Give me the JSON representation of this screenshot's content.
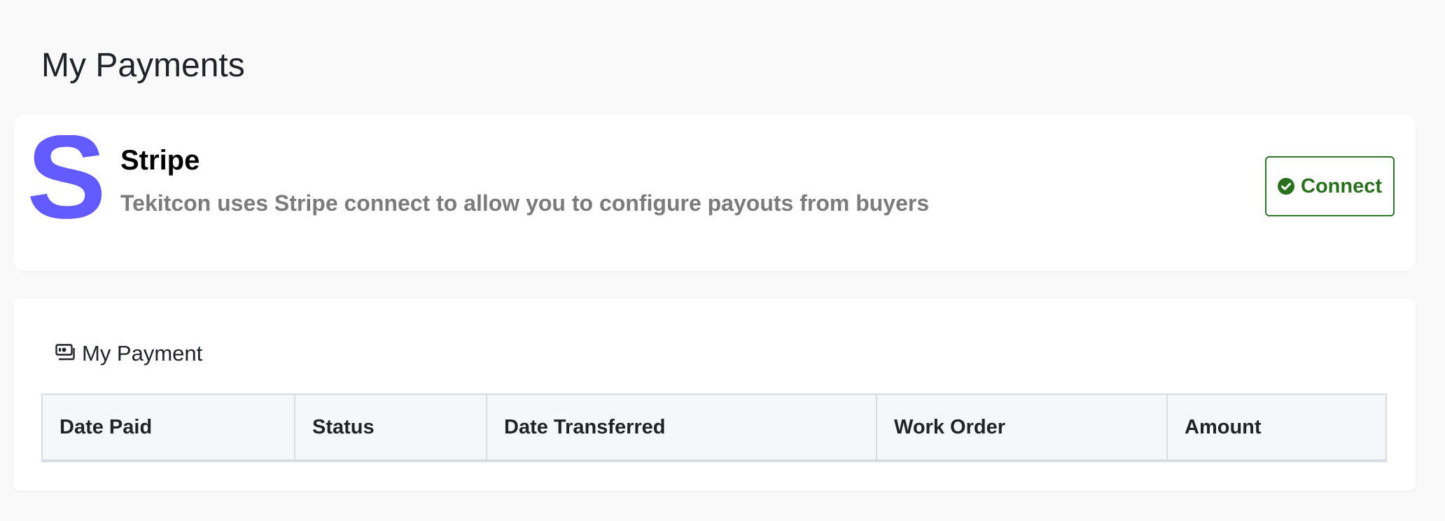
{
  "page": {
    "title": "My Payments"
  },
  "stripe": {
    "name": "Stripe",
    "description": "Tekitcon uses Stripe connect to allow you to configure payouts from buyers",
    "logo_icon": "stripe-logo-icon",
    "logo_letter": "S",
    "logo_color": "#635bff",
    "connect_button": {
      "label": "Connect",
      "icon": "check-circle-icon",
      "color": "#2a6f1e"
    }
  },
  "payments": {
    "section_icon": "money-bill-icon",
    "section_title": "My Payment",
    "table": {
      "columns": [
        "Date Paid",
        "Status",
        "Date Transferred",
        "Work Order",
        "Amount"
      ],
      "rows": []
    }
  }
}
